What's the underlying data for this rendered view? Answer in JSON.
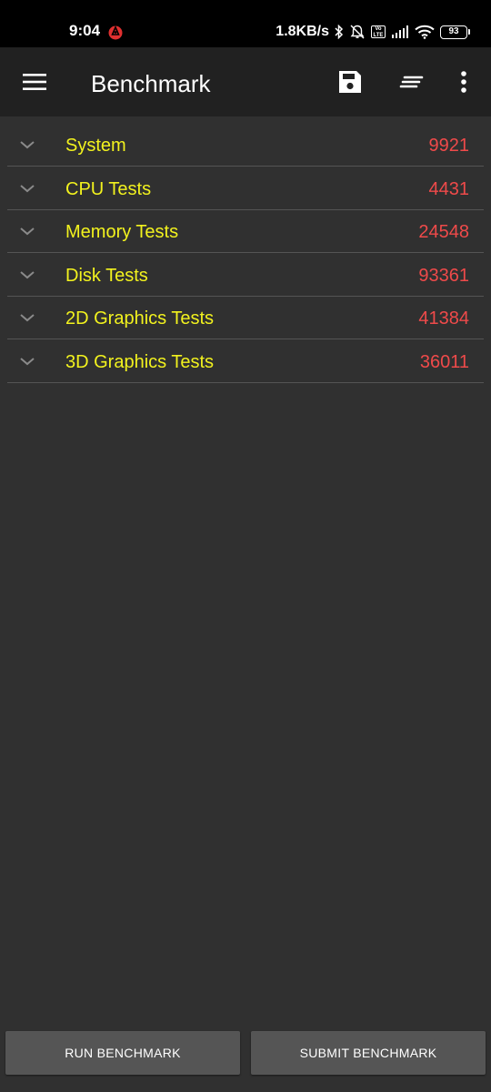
{
  "status_bar": {
    "time": "9:04",
    "net_speed": "1.8KB/s",
    "volte": "Vo LTE",
    "battery": "93",
    "icons": [
      "app-notification-icon",
      "bluetooth-icon",
      "notifications-off-icon",
      "volte-icon",
      "signal-icon",
      "wifi-icon",
      "battery-icon"
    ]
  },
  "app_bar": {
    "title": "Benchmark",
    "actions": [
      "menu-icon",
      "save-icon",
      "sort-icon",
      "more-vert-icon"
    ]
  },
  "results": [
    {
      "label": "System",
      "score": "9921"
    },
    {
      "label": "CPU Tests",
      "score": "4431"
    },
    {
      "label": "Memory Tests",
      "score": "24548"
    },
    {
      "label": "Disk Tests",
      "score": "93361"
    },
    {
      "label": "2D Graphics Tests",
      "score": "41384"
    },
    {
      "label": "3D Graphics Tests",
      "score": "36011"
    }
  ],
  "buttons": {
    "run": "RUN BENCHMARK",
    "submit": "SUBMIT BENCHMARK"
  },
  "colors": {
    "background": "#303030",
    "app_bar": "#212121",
    "label": "#f2f21e",
    "score": "#ef4a4a",
    "button": "#555555"
  }
}
